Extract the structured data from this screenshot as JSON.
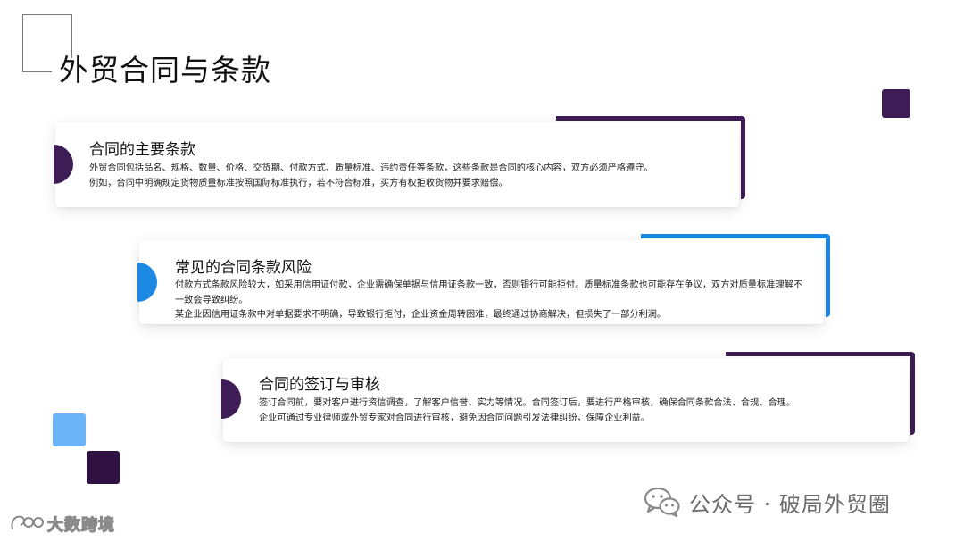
{
  "page": {
    "title": "外贸合同与条款"
  },
  "colors": {
    "dark_purple": "#3e1d57",
    "blue": "#1e88e5",
    "light_blue": "#6db3f7"
  },
  "cards": [
    {
      "title": "合同的主要条款",
      "lines": [
        "外贸合同包括品名、规格、数量、价格、交货期、付款方式、质量标准、违约责任等条款，这些条款是合同的核心内容，双方必须严格遵守。",
        "例如，合同中明确规定货物质量标准按照国际标准执行，若不符合标准，买方有权拒收货物并要求赔偿。"
      ]
    },
    {
      "title": "常见的合同条款风险",
      "lines": [
        "付款方式条款风险较大，如采用信用证付款，企业需确保单据与信用证条款一致，否则银行可能拒付。质量标准条款也可能存在争议，双方对质量标准理解不一致会导致纠纷。",
        "某企业因信用证条款中对单据要求不明确，导致银行拒付，企业资金周转困难，最终通过协商解决，但损失了一部分利润。"
      ]
    },
    {
      "title": "合同的签订与审核",
      "lines": [
        "签订合同前，要对客户进行资信调查，了解客户信誉、实力等情况。合同签订后，要进行严格审核，确保合同条款合法、合规、合理。",
        "企业可通过专业律师或外贸专家对合同进行审核，避免因合同问题引发法律纠纷，保障企业利益。"
      ]
    }
  ],
  "footer": {
    "watermark": "公众号 · 破局外贸圈",
    "logo_text": "大数跨境",
    "wechat_icon": "wechat-icon"
  }
}
